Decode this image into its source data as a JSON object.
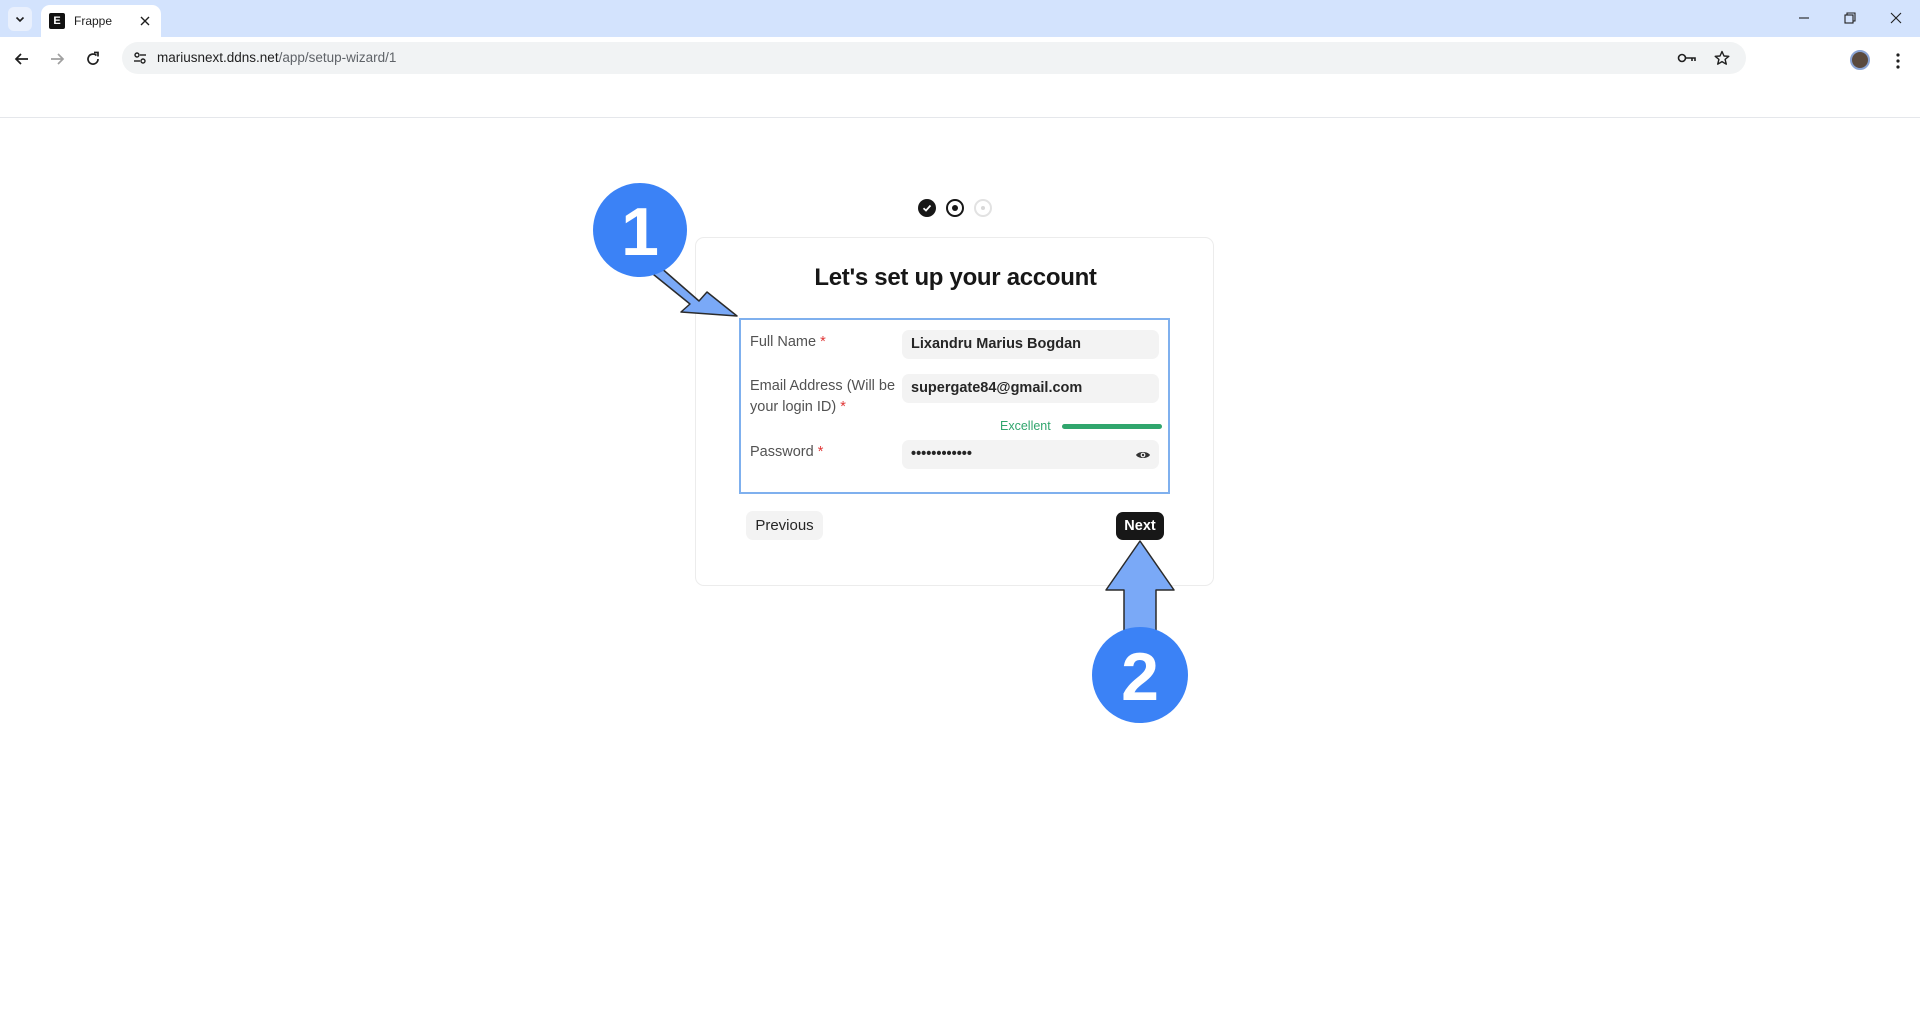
{
  "browser": {
    "tab_title": "Frappe",
    "favicon_letter": "E",
    "url_host": "mariusnext.ddns.net",
    "url_path": "/app/setup-wizard/1"
  },
  "wizard": {
    "steps_total": 3,
    "current_step": 2,
    "title": "Let's set up your account",
    "fields": {
      "full_name": {
        "label": "Full Name",
        "required_mark": "*",
        "value": "Lixandru Marius Bogdan"
      },
      "email": {
        "label_line1": "Email Address (Will be",
        "label_line2": "your login ID)",
        "required_mark": "*",
        "value": "supergate84@gmail.com"
      },
      "password": {
        "label": "Password",
        "required_mark": "*",
        "value": "••••••••••••",
        "strength_label": "Excellent",
        "strength_fraction": 1.0
      }
    },
    "previous_label": "Previous",
    "next_label": "Next"
  },
  "annotations": {
    "badge1": "1",
    "badge2": "2",
    "badge_color": "#3b82f6",
    "arrow_color": "#7aa9f7"
  },
  "colors": {
    "tabstrip": "#d3e3fd",
    "primary_button": "#171717",
    "strength_good": "#30a66d",
    "required": "#e03636"
  }
}
